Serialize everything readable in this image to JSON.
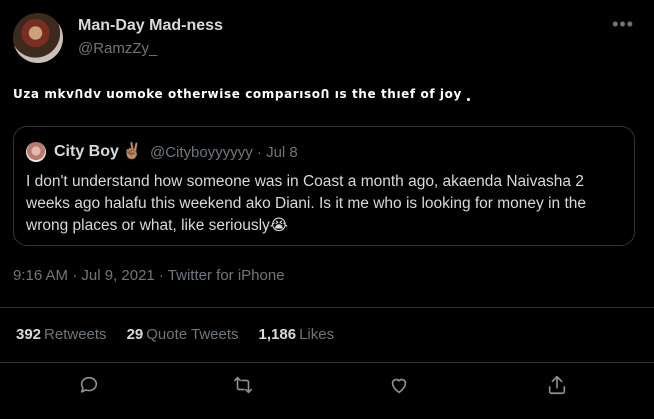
{
  "header": {
    "display_name": "Man-Day Mad-ness",
    "handle": "@RamzZy_",
    "more_label": "•••"
  },
  "tweet": {
    "text": "Uza mkvՈdv uomoke otherwise comparısoՈ ıs the thıef of joy"
  },
  "quote": {
    "name": "City Boy",
    "emoji": "✌🏽",
    "handle_date": "@Cityboyyyyyy · Jul 8",
    "text": "I don't understand how someone was in Coast a month ago, akaenda Naivasha 2 weeks ago halafu this weekend ako Diani. Is it me who is looking for money in the wrong places or what, like seriously😭"
  },
  "meta": {
    "timestamp": "9:16 AM · Jul 9, 2021 · Twitter for iPhone"
  },
  "stats": {
    "retweets_count": "392",
    "retweets_label": "Retweets",
    "quotes_count": "29",
    "quotes_label": "Quote Tweets",
    "likes_count": "1,186",
    "likes_label": "Likes"
  },
  "actions": [
    "reply-icon",
    "retweet-icon",
    "like-icon",
    "share-icon"
  ],
  "colors": {
    "background": "#000000",
    "muted": "#6e767d",
    "text": "#d9d9d9",
    "border": "#2f3336"
  }
}
